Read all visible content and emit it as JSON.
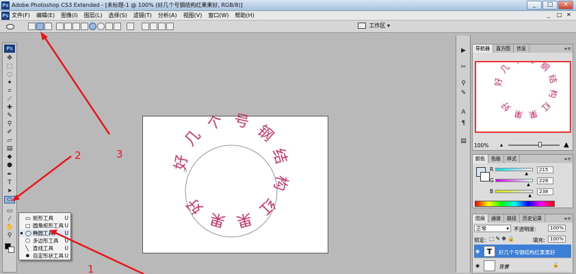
{
  "window": {
    "title": "Adobe Photoshop CS3 Extended - [未标题-1 @ 100% (好几个号钢结构红果果好, RGB/8)]",
    "app_badge": "Ps",
    "controls": [
      "_",
      "□",
      "✕"
    ]
  },
  "menu": {
    "items": [
      "文件(F)",
      "编辑(E)",
      "图像(I)",
      "图层(L)",
      "选择(S)",
      "滤镜(T)",
      "分析(A)",
      "视图(V)",
      "窗口(W)",
      "帮助(H)"
    ],
    "doc_controls": [
      "_",
      "□",
      "✕"
    ]
  },
  "options_bar": {
    "workspace_label": "工作区 ▾"
  },
  "toolbox": {
    "badge": "Ps"
  },
  "flyout": {
    "items": [
      {
        "label": "矩形工具",
        "shortcut": "U",
        "icon": "rectangle-icon"
      },
      {
        "label": "圆角矩形工具",
        "shortcut": "U",
        "icon": "rounded-rectangle-icon"
      },
      {
        "label": "椭圆工具",
        "shortcut": "U",
        "icon": "ellipse-icon",
        "current": true
      },
      {
        "label": "多边形工具",
        "shortcut": "U",
        "icon": "polygon-icon"
      },
      {
        "label": "直线工具",
        "shortcut": "U",
        "icon": "line-icon"
      },
      {
        "label": "自定形状工具",
        "shortcut": "U",
        "icon": "custom-shape-icon"
      }
    ]
  },
  "canvas": {
    "path_text": "好几个号钢结构红果果好"
  },
  "annotations": {
    "labels": [
      "1",
      "2",
      "3"
    ],
    "color": "#e8141b"
  },
  "navigator": {
    "tabs": [
      "导航器",
      "直方图",
      "信息"
    ],
    "zoom": "100%"
  },
  "color_panel": {
    "tabs": [
      "颜色",
      "色板",
      "样式"
    ],
    "channels": [
      {
        "name": "R",
        "value": "215",
        "fraction": 0.843
      },
      {
        "name": "G",
        "value": "228",
        "fraction": 0.894
      },
      {
        "name": "B",
        "value": "238",
        "fraction": 0.933
      }
    ]
  },
  "layers_panel": {
    "tabs": [
      "图层",
      "通道",
      "路径",
      "历史记录"
    ],
    "blend_mode": "正常",
    "opacity_label": "不透明度:",
    "opacity": "100%",
    "lock_label": "锁定:",
    "fill_label": "填充:",
    "fill": "100%",
    "layers": [
      {
        "name": "好几个号钢结构红果果好",
        "thumb": "T",
        "selected": true
      },
      {
        "name": "背景",
        "thumb": "",
        "selected": false
      }
    ]
  }
}
